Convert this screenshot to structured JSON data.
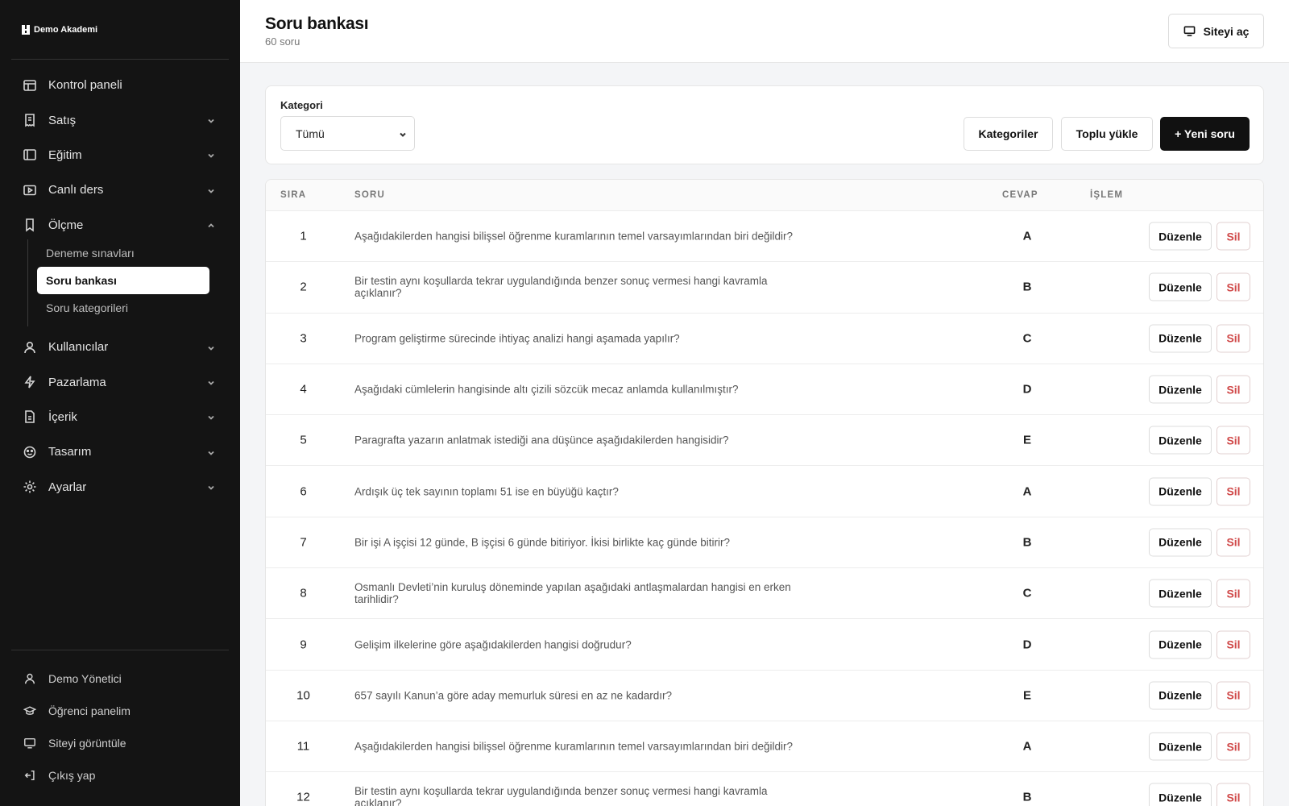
{
  "brand": {
    "name": "Demo Akademi"
  },
  "sidebar": {
    "items": [
      {
        "label": "Kontrol paneli",
        "icon": "dashboard-icon"
      },
      {
        "label": "Satış",
        "icon": "receipt-icon"
      },
      {
        "label": "Eğitim",
        "icon": "book-icon"
      },
      {
        "label": "Canlı ders",
        "icon": "video-icon"
      },
      {
        "label": "Ölçme",
        "icon": "bookmark-icon"
      },
      {
        "label": "Kullanıcılar",
        "icon": "user-icon"
      },
      {
        "label": "Pazarlama",
        "icon": "bolt-icon"
      },
      {
        "label": "İçerik",
        "icon": "file-icon"
      },
      {
        "label": "Tasarım",
        "icon": "palette-icon"
      },
      {
        "label": "Ayarlar",
        "icon": "gear-icon"
      }
    ],
    "sub_items": [
      {
        "label": "Deneme sınavları"
      },
      {
        "label": "Soru bankası"
      },
      {
        "label": "Soru kategorileri"
      }
    ],
    "bottom": [
      {
        "label": "Demo Yönetici",
        "icon": "user-icon"
      },
      {
        "label": "Öğrenci panelim",
        "icon": "graduation-cap-icon"
      },
      {
        "label": "Siteyi görüntüle",
        "icon": "monitor-icon"
      },
      {
        "label": "Çıkış yap",
        "icon": "logout-icon"
      }
    ]
  },
  "header": {
    "title": "Soru bankası",
    "subtitle": "60 soru",
    "site_button": "Siteyi aç"
  },
  "filter": {
    "label": "Kategori",
    "selected": "Tümü",
    "categories_button": "Kategoriler",
    "bulk_button": "Toplu yükle",
    "new_button": "+ Yeni soru"
  },
  "table": {
    "headers": [
      "SIRA",
      "SORU",
      "CEVAP",
      "İŞLEM"
    ],
    "edit_label": "Düzenle",
    "delete_label": "Sil",
    "rows": [
      {
        "num": "1",
        "q": "Aşağıdakilerden hangisi bilişsel öğrenme kuramlarının temel varsayımlarından biri değildir?",
        "a": "A"
      },
      {
        "num": "2",
        "q": "Bir testin aynı koşullarda tekrar uygulandığında benzer sonuç vermesi hangi kavramla açıklanır?",
        "a": "B"
      },
      {
        "num": "3",
        "q": "Program geliştirme sürecinde ihtiyaç analizi hangi aşamada yapılır?",
        "a": "C"
      },
      {
        "num": "4",
        "q": "Aşağıdaki cümlelerin hangisinde altı çizili sözcük mecaz anlamda kullanılmıştır?",
        "a": "D"
      },
      {
        "num": "5",
        "q": "Paragrafta yazarın anlatmak istediği ana düşünce aşağıdakilerden hangisidir?",
        "a": "E"
      },
      {
        "num": "6",
        "q": "Ardışık üç tek sayının toplamı 51 ise en büyüğü kaçtır?",
        "a": "A"
      },
      {
        "num": "7",
        "q": "Bir işi A işçisi 12 günde, B işçisi 6 günde bitiriyor. İkisi birlikte kaç günde bitirir?",
        "a": "B"
      },
      {
        "num": "8",
        "q": "Osmanlı Devleti’nin kuruluş döneminde yapılan aşağıdaki antlaşmalardan hangisi en erken tarihlidir?",
        "a": "C"
      },
      {
        "num": "9",
        "q": "Gelişim ilkelerine göre aşağıdakilerden hangisi doğrudur?",
        "a": "D"
      },
      {
        "num": "10",
        "q": "657 sayılı Kanun’a göre aday memurluk süresi en az ne kadardır?",
        "a": "E"
      },
      {
        "num": "11",
        "q": "Aşağıdakilerden hangisi bilişsel öğrenme kuramlarının temel varsayımlarından biri değildir?",
        "a": "A"
      },
      {
        "num": "12",
        "q": "Bir testin aynı koşullarda tekrar uygulandığında benzer sonuç vermesi hangi kavramla açıklanır?",
        "a": "B"
      }
    ]
  }
}
